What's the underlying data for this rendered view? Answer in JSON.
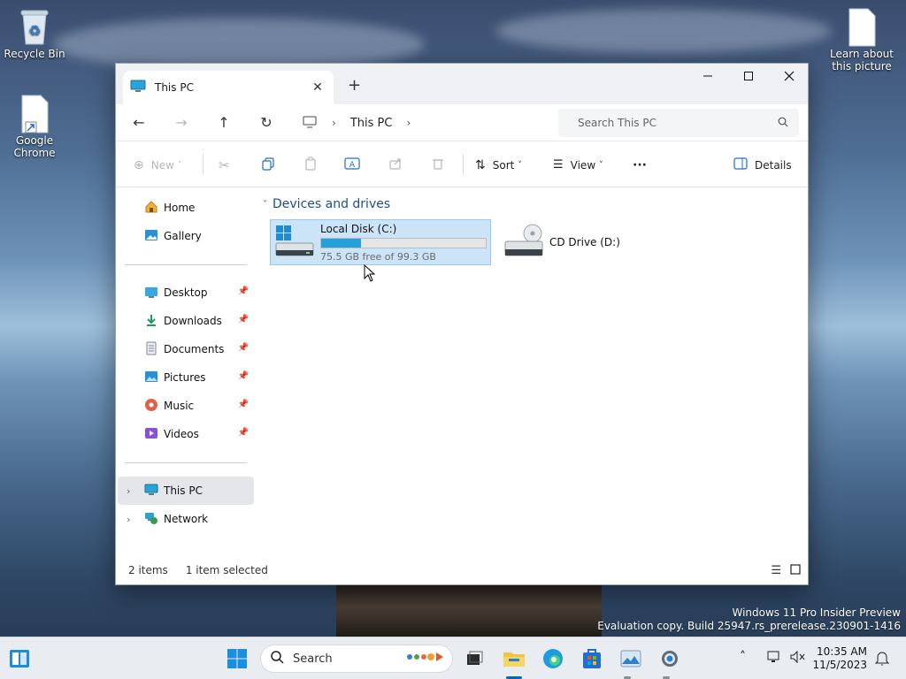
{
  "desktop": {
    "icons": [
      {
        "label": "Recycle Bin"
      },
      {
        "label": "Google Chrome"
      },
      {
        "label": "Learn about this picture"
      }
    ],
    "watermark": {
      "line1": "Windows 11 Pro Insider Preview",
      "line2": "Evaluation copy. Build 25947.rs_prerelease.230901-1416"
    }
  },
  "window": {
    "tab_title": "This PC",
    "new_tab": "+",
    "controls": {
      "minimize": "—",
      "maximize": "☐",
      "close": "✕"
    },
    "nav": {
      "breadcrumb": "This PC",
      "search_placeholder": "Search This PC"
    },
    "toolbar": {
      "new_label": "New",
      "sort_label": "Sort",
      "view_label": "View",
      "more_label": "···",
      "details_label": "Details"
    },
    "sidebar": {
      "items": [
        {
          "label": "Home",
          "icon": "home-icon"
        },
        {
          "label": "Gallery",
          "icon": "gallery-icon"
        },
        {
          "label": "Desktop",
          "icon": "desktop-folder-icon",
          "pinned": true
        },
        {
          "label": "Downloads",
          "icon": "downloads-icon",
          "pinned": true
        },
        {
          "label": "Documents",
          "icon": "documents-icon",
          "pinned": true
        },
        {
          "label": "Pictures",
          "icon": "pictures-icon",
          "pinned": true
        },
        {
          "label": "Music",
          "icon": "music-icon",
          "pinned": true
        },
        {
          "label": "Videos",
          "icon": "videos-icon",
          "pinned": true
        },
        {
          "label": "This PC",
          "icon": "this-pc-icon",
          "selected": true
        },
        {
          "label": "Network",
          "icon": "network-icon"
        }
      ]
    },
    "content": {
      "group_header": "Devices and drives",
      "drives": [
        {
          "name": "Local Disk (C:)",
          "free_text": "75.5 GB free of 99.3 GB",
          "used_fraction": 0.24,
          "selected": true
        },
        {
          "name": "CD Drive (D:)"
        }
      ]
    },
    "status": {
      "items_count": "2 items",
      "selection": "1 item selected"
    }
  },
  "taskbar": {
    "search_label": "Search",
    "time": "10:35 AM",
    "date": "11/5/2023"
  },
  "colors": {
    "accent": "#0067c0",
    "selection_bg": "#cce4f7",
    "selection_border": "#99c9ef",
    "progress_fill": "#26a0da",
    "folder_yellow": "#f3c33c"
  }
}
